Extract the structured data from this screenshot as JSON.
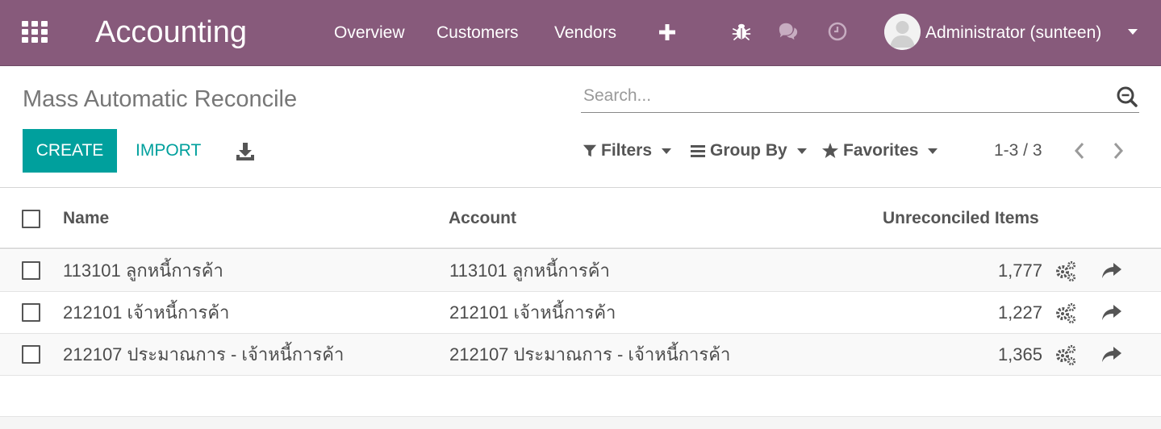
{
  "navbar": {
    "app_title": "Accounting",
    "menu": [
      "Overview",
      "Customers",
      "Vendors"
    ],
    "user": "Administrator (sunteen)"
  },
  "control_panel": {
    "breadcrumb": "Mass Automatic Reconcile",
    "search_placeholder": "Search...",
    "create_label": "CREATE",
    "import_label": "IMPORT",
    "filters_label": "Filters",
    "groupby_label": "Group By",
    "favorites_label": "Favorites",
    "pager": "1-3 / 3"
  },
  "table": {
    "headers": {
      "name": "Name",
      "account": "Account",
      "unreconciled": "Unreconciled Items"
    },
    "rows": [
      {
        "name": "113101 ลูกหนี้การค้า",
        "account": "113101 ลูกหนี้การค้า",
        "unreconciled": "1,777"
      },
      {
        "name": "212101 เจ้าหนี้การค้า",
        "account": "212101 เจ้าหนี้การค้า",
        "unreconciled": "1,227"
      },
      {
        "name": "212107 ประมาณการ - เจ้าหนี้การค้า",
        "account": "212107 ประมาณการ - เจ้าหนี้การค้า",
        "unreconciled": "1,365"
      }
    ]
  },
  "colors": {
    "navbar": "#875a7b",
    "primary": "#00a09d"
  },
  "icons": [
    "apps-grid-icon",
    "plus-icon",
    "bug-icon",
    "chat-icon",
    "clock-icon",
    "user-avatar-icon",
    "search-icon",
    "download-icon",
    "filter-icon",
    "list-icon",
    "star-icon",
    "chevron-left-icon",
    "chevron-right-icon",
    "gears-icon",
    "share-arrow-icon"
  ]
}
